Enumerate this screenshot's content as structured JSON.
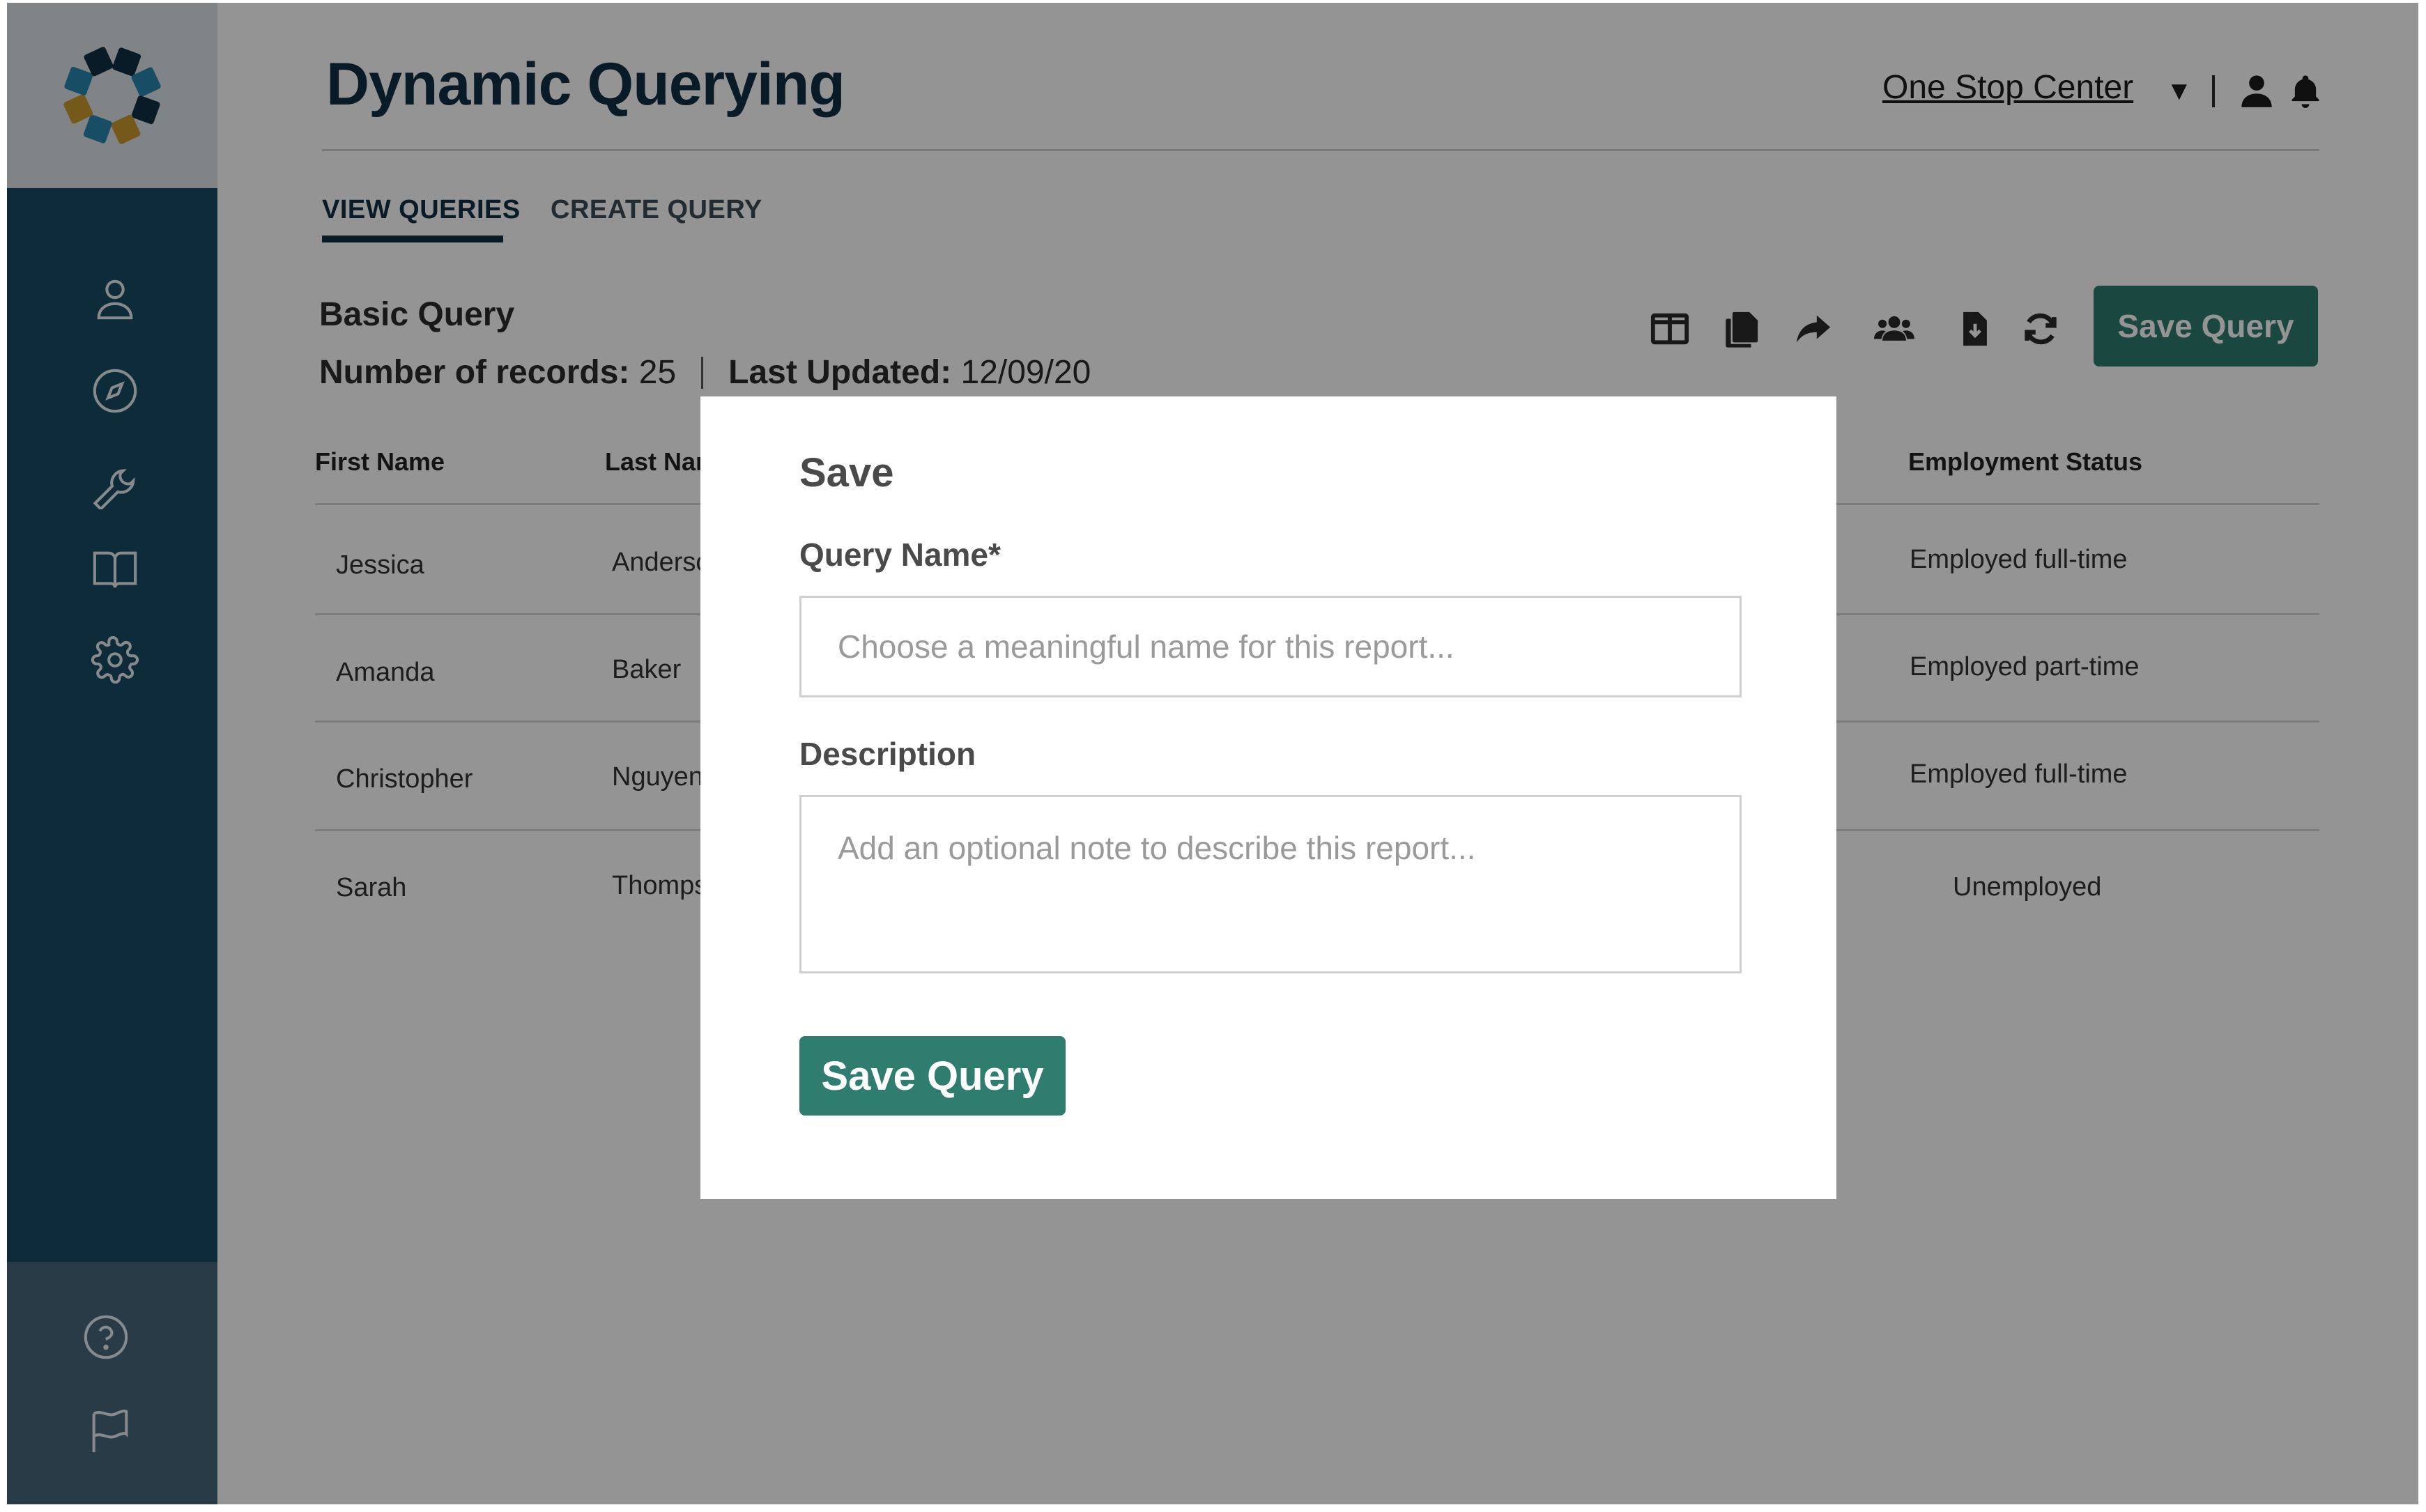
{
  "app": {
    "title": "Dynamic Querying",
    "org_selector": "One Stop Center",
    "org_caret": "▼"
  },
  "tabs": [
    {
      "label": "VIEW QUERIES",
      "active": true
    },
    {
      "label": "CREATE QUERY",
      "active": false
    }
  ],
  "query": {
    "name": "Basic Query",
    "records_label": "Number of records:",
    "records_value": "25",
    "updated_label": "Last Updated:",
    "updated_value": "12/09/20",
    "save_button": "Save Query"
  },
  "toolbar_icons": [
    "columns-icon",
    "copy-icon",
    "share-icon",
    "users-icon",
    "download-file-icon",
    "refresh-icon"
  ],
  "sidebar": {
    "nav_icons": [
      "user-icon",
      "compass-icon",
      "wrench-icon",
      "book-icon",
      "settings-icon"
    ],
    "bottom_icons": [
      "help-icon",
      "flag-icon"
    ]
  },
  "table": {
    "headers": [
      "First Name",
      "Last Name",
      "Employment Status"
    ],
    "rows": [
      {
        "first": "Jessica",
        "last": "Anderson",
        "status": "Employed full-time"
      },
      {
        "first": "Amanda",
        "last": "Baker",
        "status": "Employed part-time"
      },
      {
        "first": "Christopher",
        "last": "Nguyen",
        "status": "Employed full-time"
      },
      {
        "first": "Sarah",
        "last": "Thompson",
        "status": "Unemployed"
      }
    ]
  },
  "modal": {
    "title": "Save",
    "name_label": "Query Name*",
    "name_placeholder": "Choose a meaningful name for this report...",
    "description_label": "Description",
    "description_placeholder": "Add an optional note to describe this report...",
    "save_button": "Save Query"
  },
  "colors": {
    "sidebar": "#174a62",
    "primary_button": "#2e7d6e",
    "title_text": "#0f2f42",
    "overlay": "rgba(0,0,0,0.42)"
  }
}
